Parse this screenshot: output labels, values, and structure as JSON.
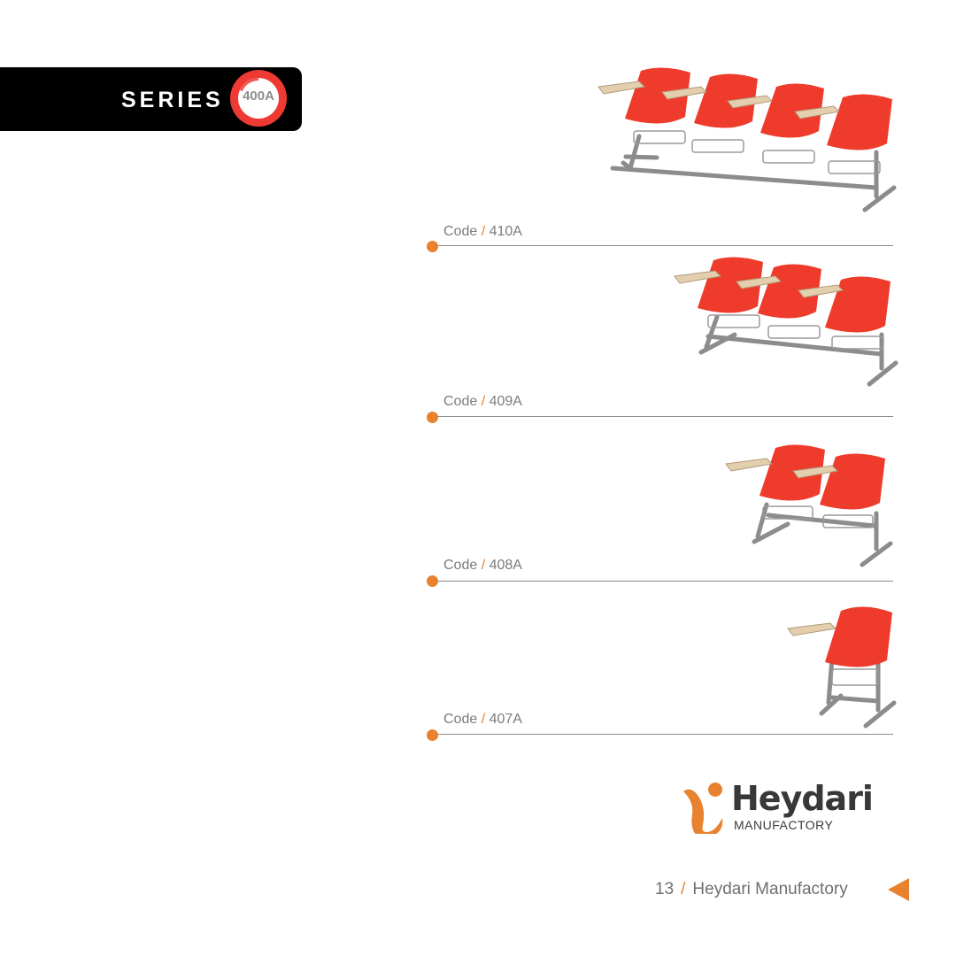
{
  "series": {
    "label": "SERIES",
    "badge": "400A",
    "badge_color": "#ee3a33"
  },
  "products": [
    {
      "code_prefix": "Code",
      "separator": "/",
      "code": "410A",
      "seats": 4
    },
    {
      "code_prefix": "Code",
      "separator": "/",
      "code": "409A",
      "seats": 3
    },
    {
      "code_prefix": "Code",
      "separator": "/",
      "code": "408A",
      "seats": 2
    },
    {
      "code_prefix": "Code",
      "separator": "/",
      "code": "407A",
      "seats": 1
    }
  ],
  "logo": {
    "name": "Heydari",
    "subtitle": "MANUFACTORY"
  },
  "footer": {
    "page_number": "13",
    "separator": "/",
    "company": "Heydari Manufactory",
    "nav_icon": "triangle-left-icon"
  },
  "colors": {
    "accent": "#e9822f",
    "seat": "#ee3b2b",
    "banner": "#000000"
  }
}
